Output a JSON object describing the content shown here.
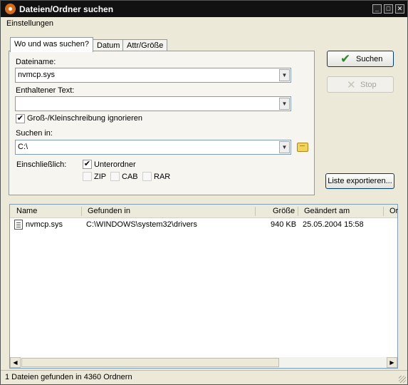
{
  "window": {
    "title": "Dateien/Ordner suchen"
  },
  "menu": {
    "settings": "Einstellungen"
  },
  "tabs": [
    {
      "label": "Wo und was suchen?",
      "active": true
    },
    {
      "label": "Datum",
      "active": false
    },
    {
      "label": "Attr/Größe",
      "active": false
    }
  ],
  "form": {
    "filename_label": "Dateiname:",
    "filename_value": "nvmcp.sys",
    "contained_text_label": "Enthaltener Text:",
    "contained_text_value": "",
    "ignore_case_label": "Groß-/Kleinschreibung ignorieren",
    "ignore_case_checked": true,
    "search_in_label": "Suchen in:",
    "search_in_value": "C:\\",
    "only_label": "Einschließlich:",
    "subfolders_label": "Unterordner",
    "subfolders_checked": true,
    "zip_label": "ZIP",
    "cab_label": "CAB",
    "rar_label": "RAR"
  },
  "buttons": {
    "search": "Suchen",
    "stop": "Stop",
    "export": "Liste exportieren..."
  },
  "results": {
    "columns": [
      "Name",
      "Gefunden in",
      "Größe",
      "Geändert am",
      "Or"
    ],
    "rows": [
      {
        "name": "nvmcp.sys",
        "path": "C:\\WINDOWS\\system32\\drivers",
        "size": "940 KB",
        "modified": "25.05.2004 15:58"
      }
    ]
  },
  "status": "1 Dateien gefunden in 4360 Ordnern",
  "colors": {
    "titlebar": "#111111",
    "accent": "#2a8a2a",
    "panel": "#ece9d8"
  }
}
